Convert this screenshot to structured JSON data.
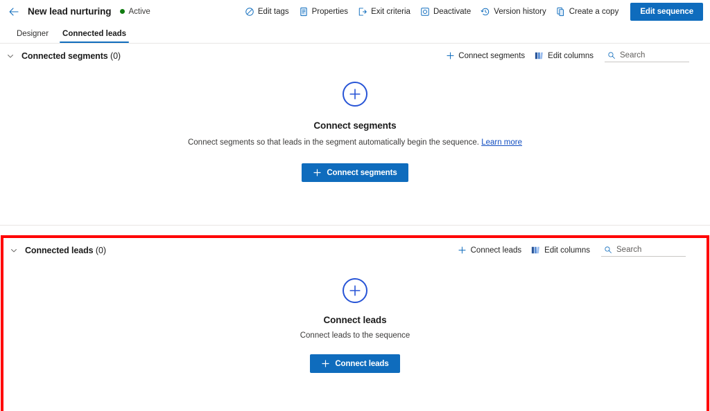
{
  "header": {
    "back_icon": "arrow-left-icon",
    "title": "New lead nurturing",
    "status": "Active",
    "status_color": "#107c10",
    "commands": [
      {
        "label": "Edit tags",
        "icon": "tag-icon"
      },
      {
        "label": "Properties",
        "icon": "document-properties-icon"
      },
      {
        "label": "Exit criteria",
        "icon": "exit-icon"
      },
      {
        "label": "Deactivate",
        "icon": "deactivate-icon"
      },
      {
        "label": "Version history",
        "icon": "history-icon"
      },
      {
        "label": "Create a copy",
        "icon": "copy-icon"
      }
    ],
    "primary_button": "Edit sequence"
  },
  "tabs": [
    {
      "label": "Designer",
      "active": false
    },
    {
      "label": "Connected leads",
      "active": true
    }
  ],
  "segments_section": {
    "title": "Connected segments",
    "count": "(0)",
    "chevron": "chevron-down-icon",
    "actions": {
      "connect_label": "Connect segments",
      "edit_columns_label": "Edit columns"
    },
    "search_placeholder": "Search",
    "empty": {
      "icon": "plus-circle-icon",
      "title": "Connect segments",
      "description": "Connect segments so that leads in the segment automatically begin the sequence.",
      "link_text": "Learn more",
      "cta_label": "Connect segments"
    }
  },
  "leads_section": {
    "title": "Connected leads",
    "count": "(0)",
    "chevron": "chevron-down-icon",
    "highlight_color": "#ff0000",
    "actions": {
      "connect_label": "Connect leads",
      "edit_columns_label": "Edit columns"
    },
    "search_placeholder": "Search",
    "empty": {
      "icon": "plus-circle-icon",
      "title": "Connect leads",
      "description": "Connect leads to the sequence",
      "cta_label": "Connect leads"
    }
  },
  "colors": {
    "accent": "#0f6cbd",
    "plus_circle": "#2754d6",
    "link": "#0f4cc0",
    "highlight": "#ff0000"
  }
}
